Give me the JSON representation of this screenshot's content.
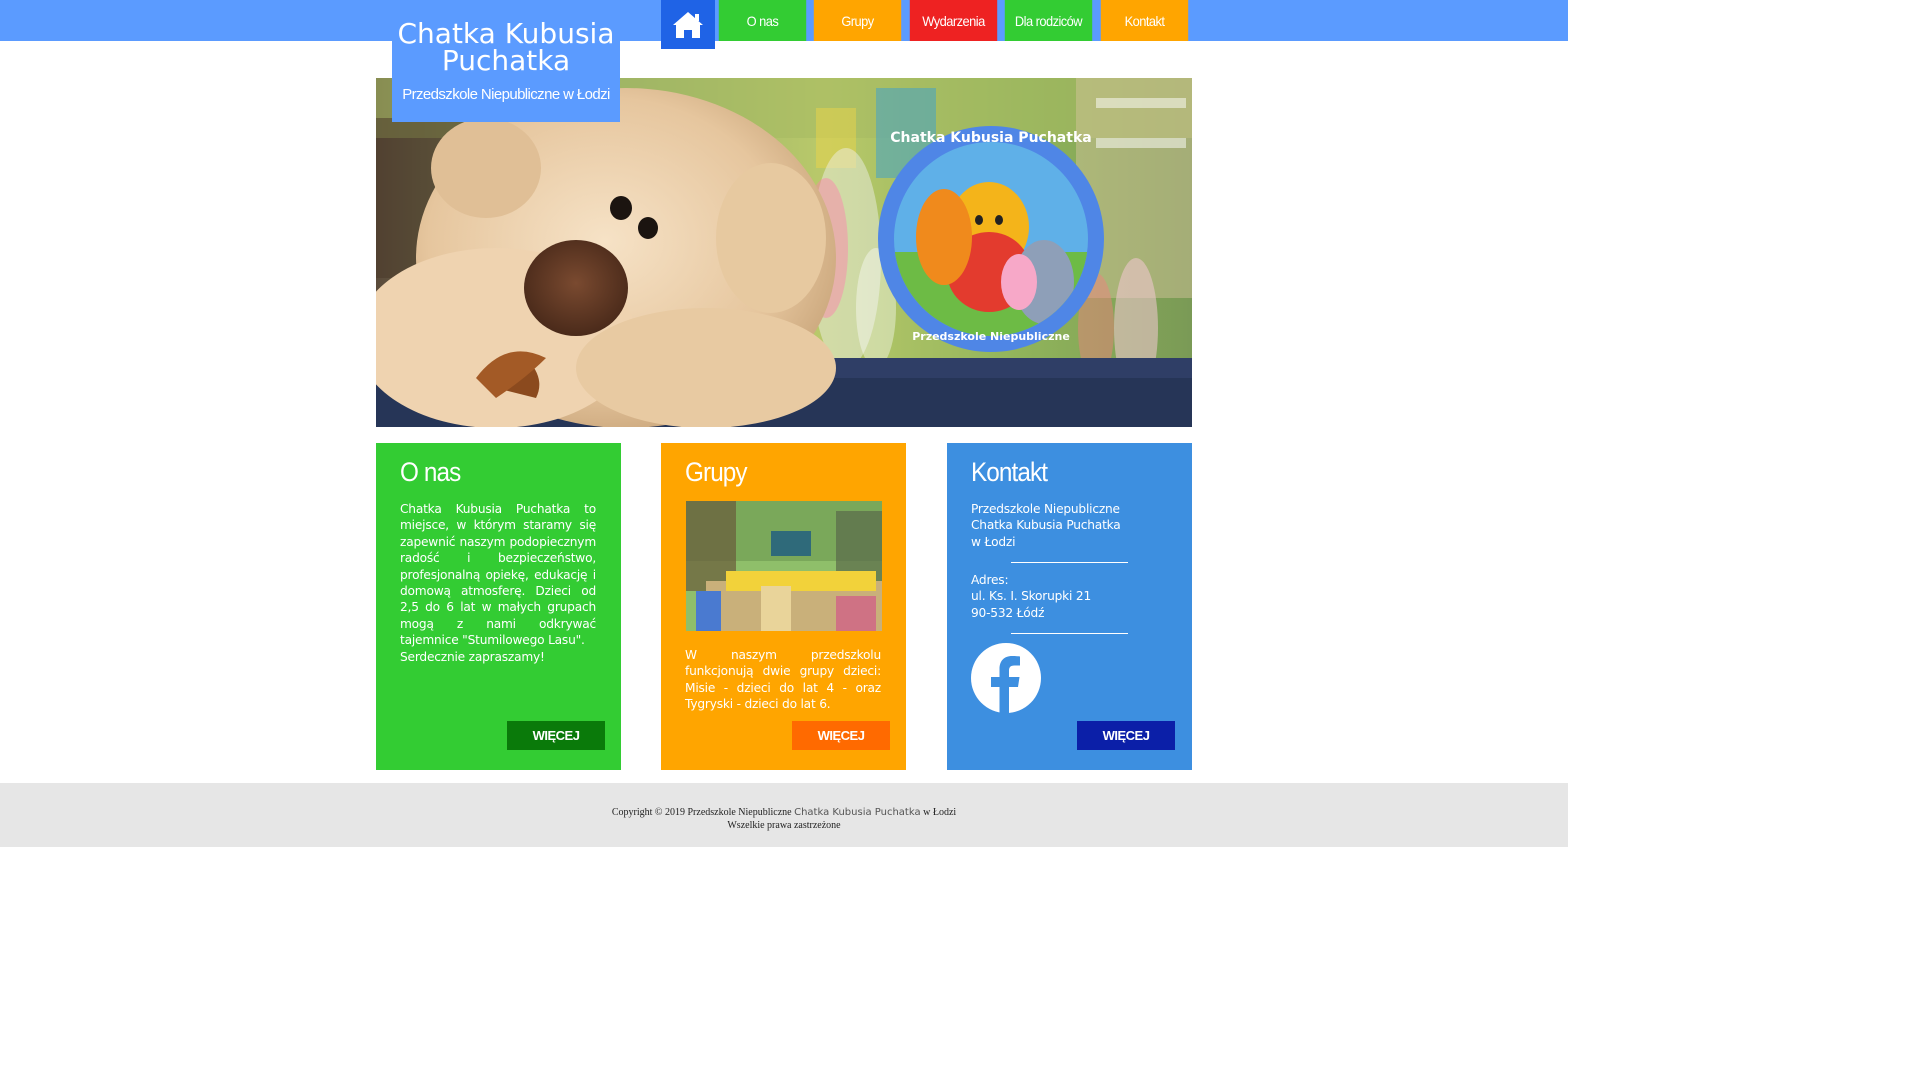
{
  "header": {
    "title": "Chatka Kubusia Puchatka",
    "subtitle": "Przedszkole Niepubliczne w Łodzi",
    "nav": [
      {
        "label": "O nas",
        "color": "#33cc33"
      },
      {
        "label": "Grupy",
        "color": "#ffa500"
      },
      {
        "label": "Wydarzenia",
        "color": "#ee2222"
      },
      {
        "label": "Dla rodziców",
        "color": "#33cc33"
      },
      {
        "label": "Kontakt",
        "color": "#ffa500"
      }
    ],
    "home_icon": "home-icon"
  },
  "hero": {
    "badge_top": "Chatka Kubusia Puchatka",
    "badge_bottom": "Przedszkole Niepubliczne"
  },
  "cards": {
    "about": {
      "title": "O nas",
      "text": "Chatka Kubusia Puchatka to miejsce, w którym staramy się zapewnić naszym podopiecznym radość i bezpieczeństwo, profesjonalną opiekę, edukację i domową atmosferę. Dzieci od 2,5 do 6 lat w małych grupach mogą z nami odkrywać tajemnice \"Stumilowego Lasu\".",
      "text2": "Serdecznie zapraszamy!",
      "button": "WIĘCEJ",
      "color": "#33cc33",
      "button_color": "#0a7a0a"
    },
    "groups": {
      "title": "Grupy",
      "text": "W naszym przedszkolu funkcjonują dwie grupy dzieci: Misie - dzieci do lat 4 - oraz Tygryski - dzieci do lat 6.",
      "button": "WIĘCEJ",
      "color": "#ffa500",
      "button_color": "#ff6a00"
    },
    "contact": {
      "title": "Kontakt",
      "name_lines": [
        "Przedszkole Niepubliczne",
        "Chatka Kubusia Puchatka",
        "w Łodzi"
      ],
      "address_label": "Adres:",
      "address_lines": [
        "ul. Ks. I. Skorupki 21",
        "90-532 Łódź"
      ],
      "social_icon": "facebook-icon",
      "button": "WIĘCEJ",
      "color": "#3d8fe0",
      "button_color": "#0b1fa8"
    }
  },
  "footer": {
    "copyright_prefix": "Copyright © 2019 Przedszkole Niepubliczne",
    "copyright_name": "Chatka Kubusia Puchatka",
    "copyright_suffix": "w Łodzi",
    "rights": "Wszelkie prawa zastrzeżone"
  }
}
